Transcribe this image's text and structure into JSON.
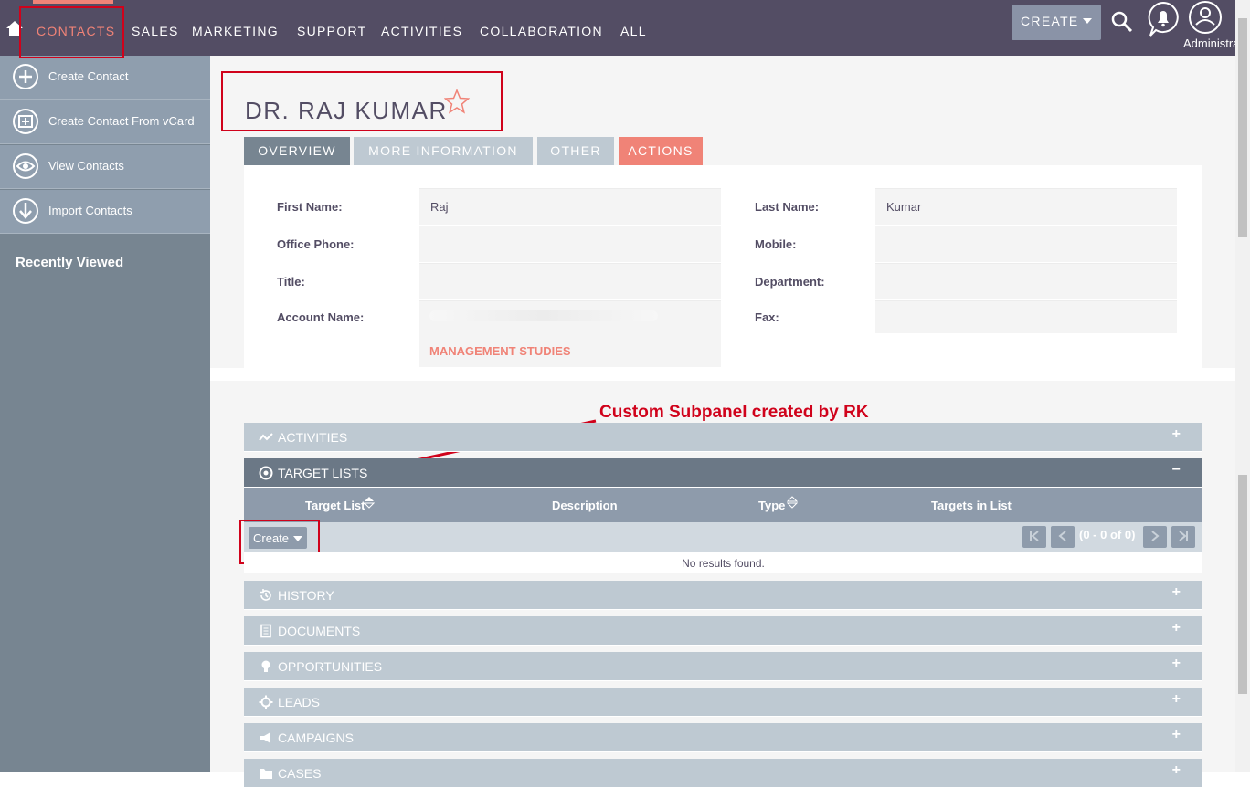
{
  "topnav": {
    "items": [
      "CONTACTS",
      "SALES",
      "MARKETING",
      "SUPPORT",
      "ACTIVITIES",
      "COLLABORATION",
      "ALL"
    ],
    "create_label": "CREATE",
    "user_label": "Administrator"
  },
  "sidebar": {
    "actions": [
      {
        "label": "Create Contact",
        "icon": "plus-circle-icon"
      },
      {
        "label": "Create Contact From vCard",
        "icon": "vcard-icon"
      },
      {
        "label": "View Contacts",
        "icon": "eye-icon"
      },
      {
        "label": "Import Contacts",
        "icon": "download-icon"
      }
    ],
    "recently_viewed": "Recently Viewed"
  },
  "record": {
    "title": "DR. RAJ KUMAR",
    "tabs": [
      "OVERVIEW",
      "MORE INFORMATION",
      "OTHER",
      "ACTIONS"
    ],
    "fields": {
      "first_name_label": "First Name:",
      "first_name": "Raj",
      "last_name_label": "Last Name:",
      "last_name": "Kumar",
      "office_phone_label": "Office Phone:",
      "office_phone": "",
      "mobile_label": "Mobile:",
      "mobile": "",
      "title_label": "Title:",
      "title": "",
      "department_label": "Department:",
      "department": "",
      "account_name_label": "Account Name:",
      "account_name_link": "MANAGEMENT STUDIES",
      "fax_label": "Fax:",
      "fax": ""
    }
  },
  "annotation": "Custom Subpanel created by RK",
  "subpanels": {
    "activities": "ACTIVITIES",
    "target_lists": "TARGET LISTS",
    "history": "HISTORY",
    "documents": "DOCUMENTS",
    "opportunities": "OPPORTUNITIES",
    "leads": "LEADS",
    "campaigns": "CAMPAIGNS",
    "cases": "CASES",
    "expand_symbol": "+",
    "collapse_symbol": "−"
  },
  "target_list_table": {
    "columns": [
      "Target List",
      "Description",
      "Type",
      "Targets in List"
    ],
    "create_label": "Create",
    "pagination": "(0 - 0 of 0)",
    "empty_message": "No results found."
  },
  "colors": {
    "nav_bg": "#534d64",
    "accent": "#f08377",
    "sidebar_bg": "#778591",
    "annotation_red": "#d0021b"
  }
}
